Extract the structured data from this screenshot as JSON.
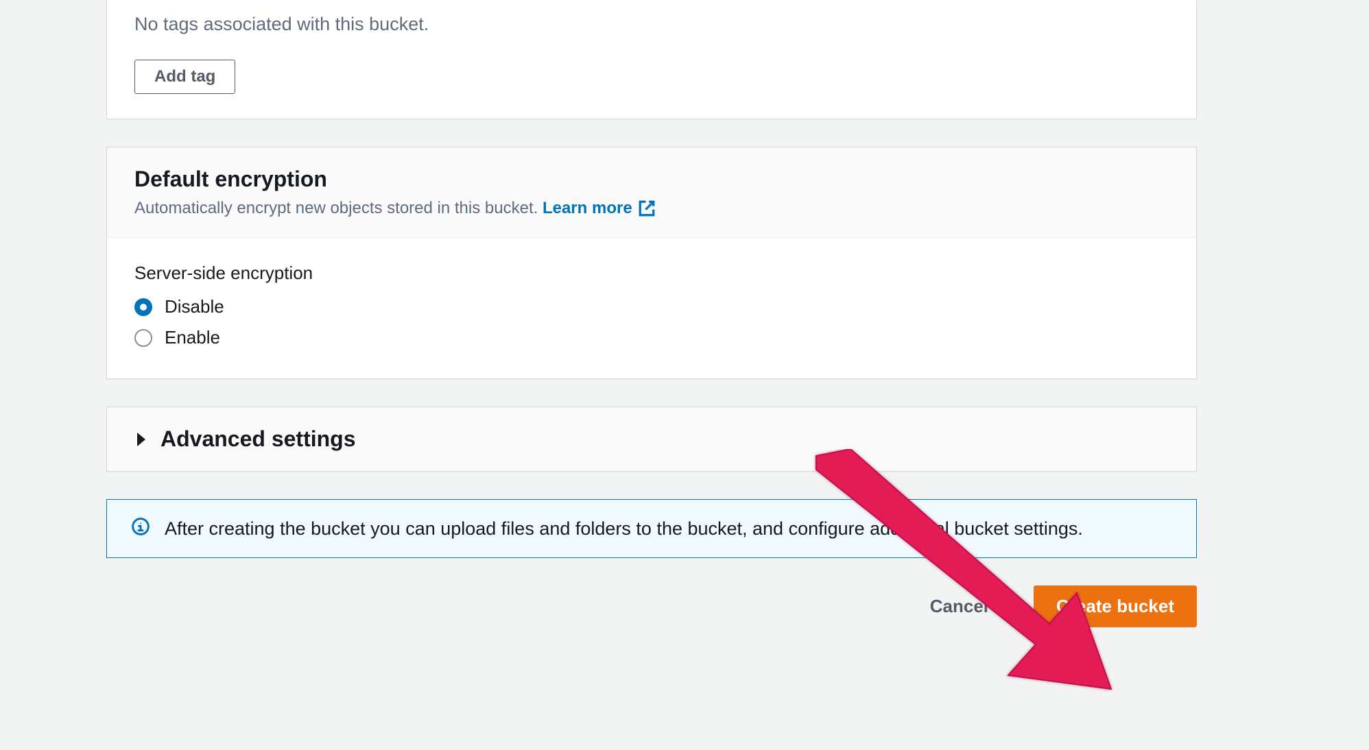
{
  "tags": {
    "empty_message": "No tags associated with this bucket.",
    "add_button_label": "Add tag"
  },
  "encryption": {
    "title": "Default encryption",
    "description": "Automatically encrypt new objects stored in this bucket.",
    "learn_more_label": "Learn more",
    "field_label": "Server-side encryption",
    "options": {
      "disable": "Disable",
      "enable": "Enable"
    },
    "selected": "disable"
  },
  "advanced": {
    "title": "Advanced settings"
  },
  "info": {
    "message": "After creating the bucket you can upload files and folders to the bucket, and configure additional bucket settings."
  },
  "actions": {
    "cancel_label": "Cancel",
    "create_label": "Create bucket"
  },
  "colors": {
    "link": "#0073bb",
    "primary": "#ec7211",
    "body_bg": "#f2f3f3",
    "panel_border": "#d5dbdb",
    "muted_text": "#5f6b7a"
  }
}
